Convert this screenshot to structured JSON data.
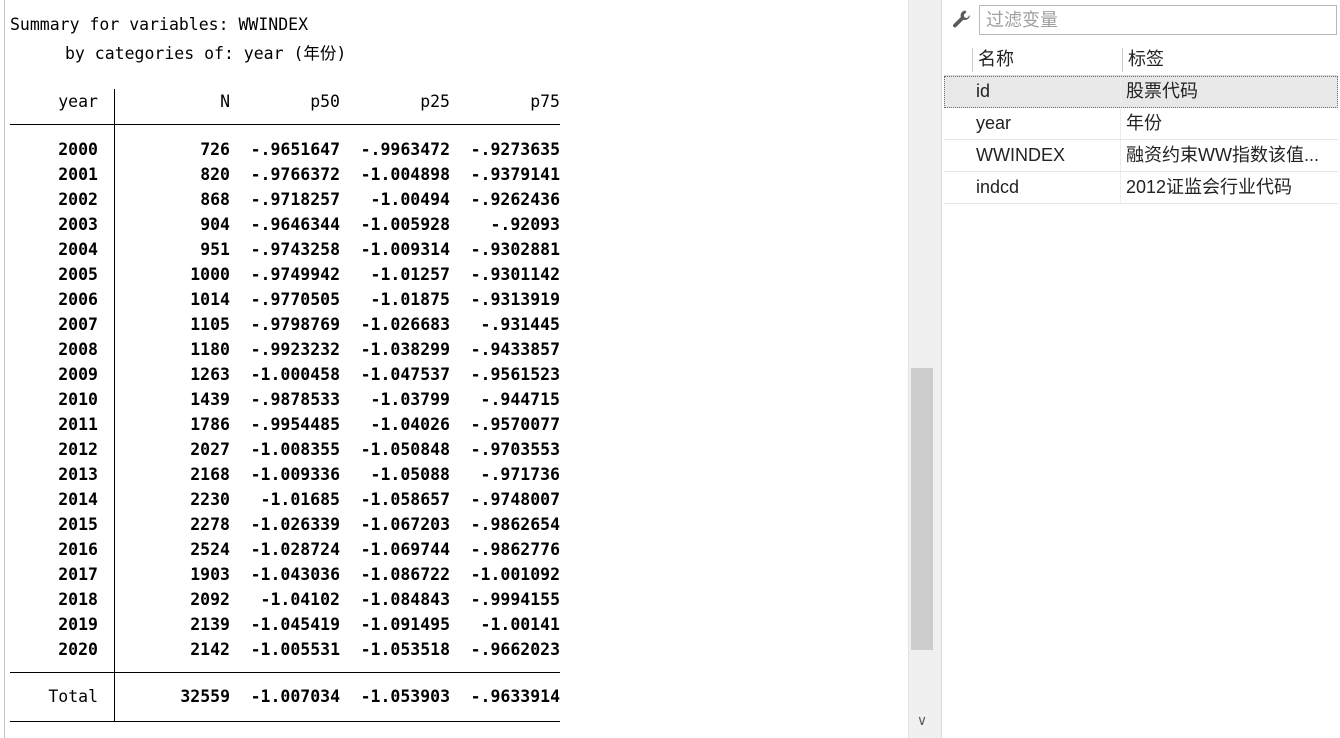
{
  "results": {
    "title_line": "Summary for variables: WWINDEX",
    "by_line": "by categories of: year (年份)",
    "columns": [
      "year",
      "N",
      "p50",
      "p25",
      "p75"
    ],
    "rows": [
      [
        "2000",
        "726",
        "-.9651647",
        "-.9963472",
        "-.9273635"
      ],
      [
        "2001",
        "820",
        "-.9766372",
        "-1.004898",
        "-.9379141"
      ],
      [
        "2002",
        "868",
        "-.9718257",
        "-1.00494",
        "-.9262436"
      ],
      [
        "2003",
        "904",
        "-.9646344",
        "-1.005928",
        "-.92093"
      ],
      [
        "2004",
        "951",
        "-.9743258",
        "-1.009314",
        "-.9302881"
      ],
      [
        "2005",
        "1000",
        "-.9749942",
        "-1.01257",
        "-.9301142"
      ],
      [
        "2006",
        "1014",
        "-.9770505",
        "-1.01875",
        "-.9313919"
      ],
      [
        "2007",
        "1105",
        "-.9798769",
        "-1.026683",
        "-.931445"
      ],
      [
        "2008",
        "1180",
        "-.9923232",
        "-1.038299",
        "-.9433857"
      ],
      [
        "2009",
        "1263",
        "-1.000458",
        "-1.047537",
        "-.9561523"
      ],
      [
        "2010",
        "1439",
        "-.9878533",
        "-1.03799",
        "-.944715"
      ],
      [
        "2011",
        "1786",
        "-.9954485",
        "-1.04026",
        "-.9570077"
      ],
      [
        "2012",
        "2027",
        "-1.008355",
        "-1.050848",
        "-.9703553"
      ],
      [
        "2013",
        "2168",
        "-1.009336",
        "-1.05088",
        "-.971736"
      ],
      [
        "2014",
        "2230",
        "-1.01685",
        "-1.058657",
        "-.9748007"
      ],
      [
        "2015",
        "2278",
        "-1.026339",
        "-1.067203",
        "-.9862654"
      ],
      [
        "2016",
        "2524",
        "-1.028724",
        "-1.069744",
        "-.9862776"
      ],
      [
        "2017",
        "1903",
        "-1.043036",
        "-1.086722",
        "-1.001092"
      ],
      [
        "2018",
        "2092",
        "-1.04102",
        "-1.084843",
        "-.9994155"
      ],
      [
        "2019",
        "2139",
        "-1.045419",
        "-1.091495",
        "-1.00141"
      ],
      [
        "2020",
        "2142",
        "-1.005531",
        "-1.053518",
        "-.9662023"
      ]
    ],
    "total": [
      "Total",
      "32559",
      "-1.007034",
      "-1.053903",
      "-.9633914"
    ]
  },
  "scrollbar": {
    "down_arrow_icon": "chevron-down-icon",
    "down_glyph": "∨"
  },
  "variables_panel": {
    "tool_icon": "wrench-icon",
    "filter_placeholder": "过滤变量",
    "filter_value": "",
    "headers": {
      "name": "名称",
      "label": "标签"
    },
    "items": [
      {
        "name": "id",
        "label": "股票代码",
        "selected": true
      },
      {
        "name": "year",
        "label": "年份",
        "selected": false
      },
      {
        "name": "WWINDEX",
        "label": "融资约束WW指数该值...",
        "selected": false
      },
      {
        "name": "indcd",
        "label": "2012证监会行业代码",
        "selected": false
      }
    ]
  }
}
